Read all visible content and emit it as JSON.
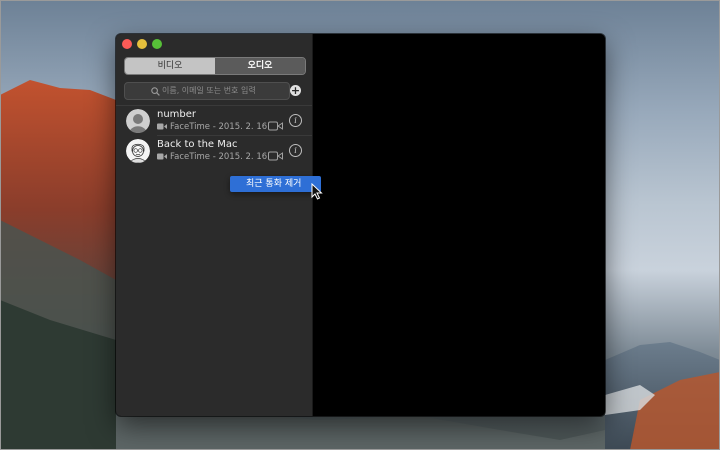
{
  "window": {
    "segmented_control": {
      "video_label": "비디오",
      "audio_label": "오디오",
      "selected": "audio"
    },
    "search": {
      "placeholder": "이름, 이메일 또는 번호 입력"
    },
    "recent_calls": [
      {
        "name": "number",
        "detail": "FaceTime - 2015. 2. 16."
      },
      {
        "name": "Back to the Mac",
        "detail": "FaceTime - 2015. 2. 16."
      }
    ]
  },
  "context_menu": {
    "items": [
      {
        "label": "최근 통화 제거",
        "highlighted": true
      }
    ]
  },
  "colors": {
    "close": "#fc5b57",
    "minimize": "#e5bf3c",
    "maximize": "#57c038",
    "menu_highlight": "#2e6fd6",
    "sidebar": "#2b2b2b"
  },
  "icons": [
    "search-icon",
    "add-icon",
    "video-camera-icon",
    "info-icon",
    "mouse-pointer-icon"
  ]
}
